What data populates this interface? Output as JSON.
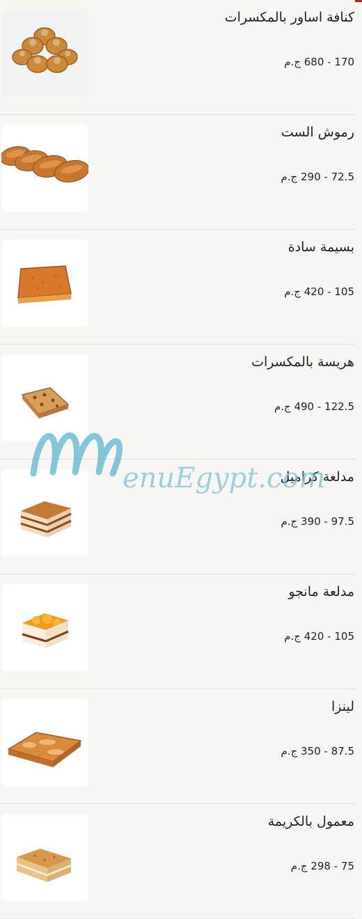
{
  "items": [
    {
      "name": "كنافة اساور بالمكسرات",
      "price": "170 - 680 ج.م",
      "image": "kunafa-nests-image"
    },
    {
      "name": "رموش الست",
      "price": "72.5 - 290 ج.م",
      "image": "rumush-alsit-image"
    },
    {
      "name": "بسيمة سادة",
      "price": "105 - 420 ج.م",
      "image": "basbousa-plain-image"
    },
    {
      "name": "هريسة بالمكسرات",
      "price": "122.5 - 490 ج.م",
      "image": "harissa-nuts-image"
    },
    {
      "name": "مدلعة كراميل",
      "price": "97.5 - 390 ج.م",
      "image": "caramel-cake-image"
    },
    {
      "name": "مدلعة مانجو",
      "price": "105 - 420 ج.م",
      "image": "mango-cake-image"
    },
    {
      "name": "لينزا",
      "price": "87.5 - 350 ج.م",
      "image": "linza-image"
    },
    {
      "name": "معمول بالكريمة",
      "price": "75 - 298 ج.م",
      "image": "maamoul-cream-image"
    }
  ],
  "watermark": {
    "text": "enuEgypt.com"
  }
}
